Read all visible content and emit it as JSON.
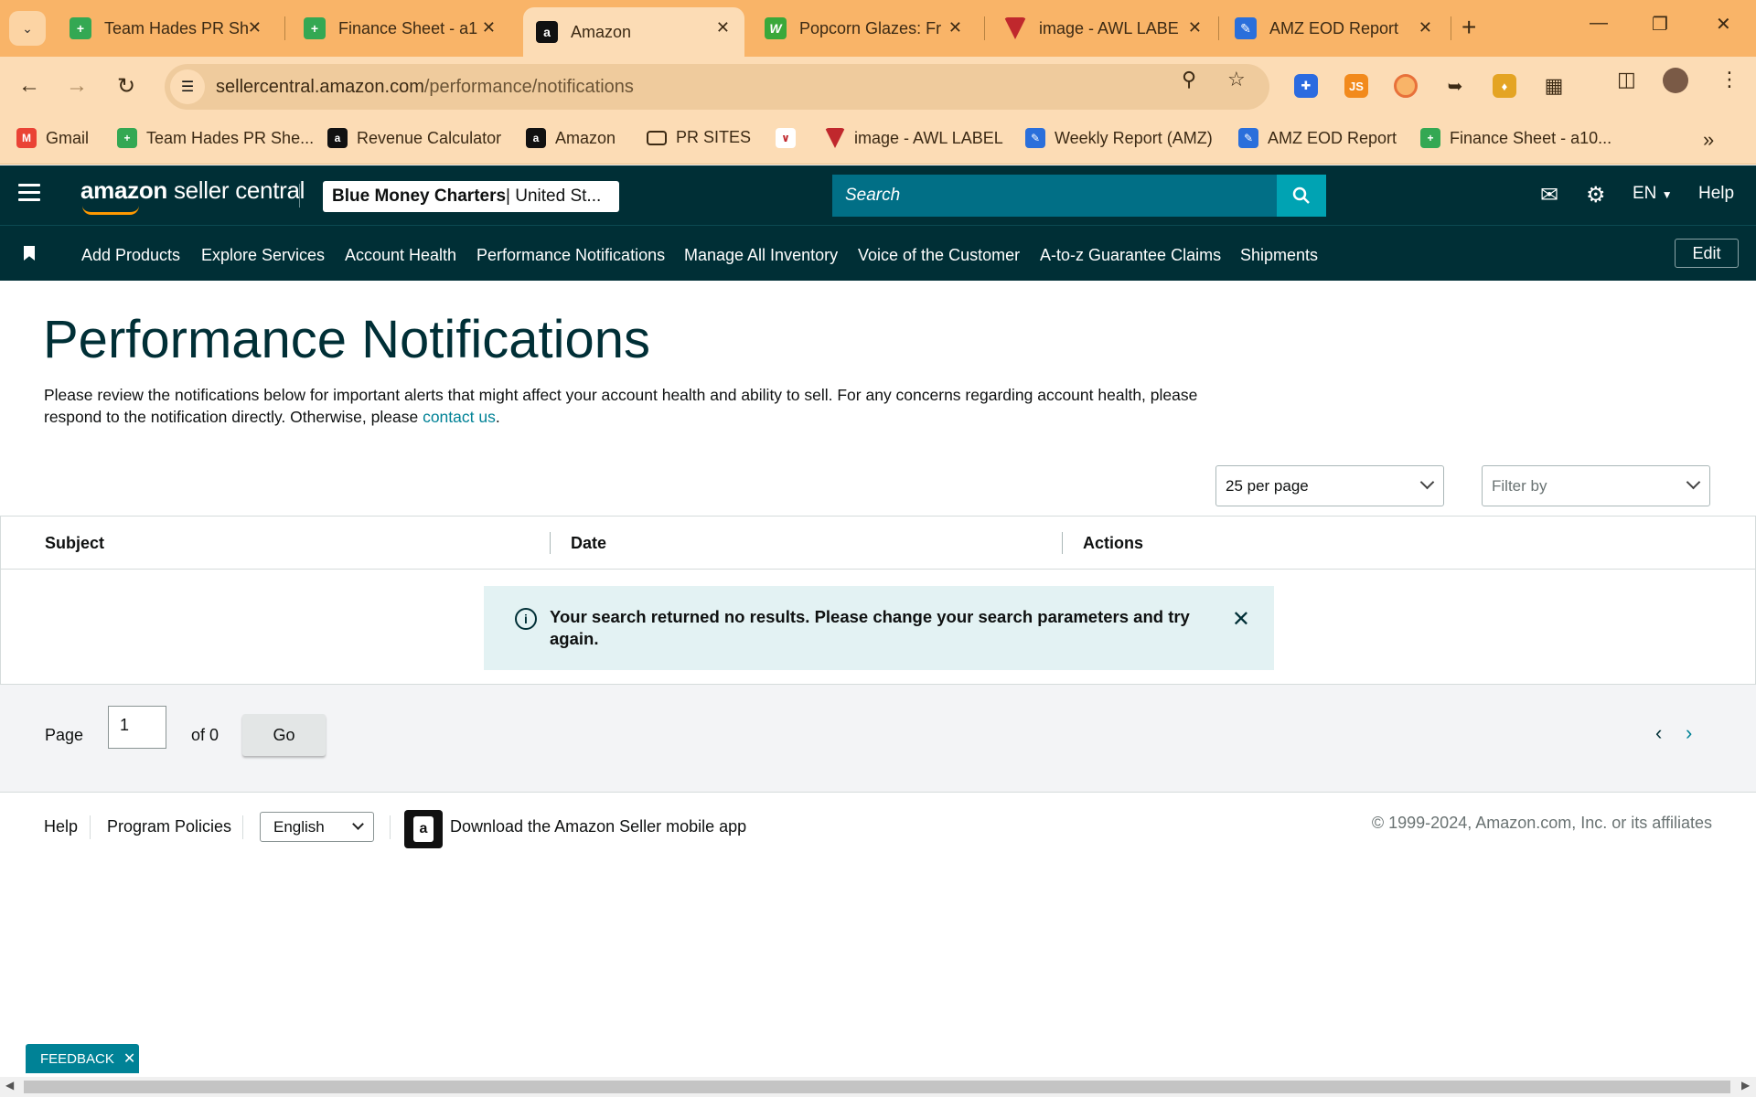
{
  "browser": {
    "tabs": [
      {
        "title": "Team Hades PR Sh",
        "icon": "sheets-plus-icon",
        "color": "#34a853",
        "active": false
      },
      {
        "title": "Finance Sheet - a1",
        "icon": "sheets-plus-icon",
        "color": "#34a853",
        "active": false
      },
      {
        "title": "Amazon",
        "icon": "amazon-a-icon",
        "color": "#111111",
        "active": true
      },
      {
        "title": "Popcorn Glazes: Fr",
        "icon": "w-logo-icon",
        "color": "#3aa83a",
        "active": false
      },
      {
        "title": "image - AWL LABE",
        "icon": "awl-label-icon",
        "color": "#c0282d",
        "active": false
      },
      {
        "title": "AMZ EOD Report",
        "icon": "report-pen-icon",
        "color": "#2a6fdb",
        "active": false
      }
    ],
    "url_domain": "sellercentral.amazon.com",
    "url_path": "/performance/notifications",
    "bookmarks": [
      {
        "label": "Gmail",
        "icon": "gmail-icon"
      },
      {
        "label": "Team Hades PR She...",
        "icon": "sheets-plus-icon"
      },
      {
        "label": "Revenue Calculator",
        "icon": "amazon-a-icon"
      },
      {
        "label": "Amazon",
        "icon": "amazon-a-icon"
      },
      {
        "label": "PR SITES",
        "icon": "folder-icon"
      },
      {
        "label": "",
        "icon": "chart-image-icon"
      },
      {
        "label": "image - AWL LABEL",
        "icon": "awl-label-icon"
      },
      {
        "label": "Weekly Report (AMZ)",
        "icon": "report-pen-icon"
      },
      {
        "label": "AMZ EOD Report",
        "icon": "report-pen-icon"
      },
      {
        "label": "Finance Sheet - a10...",
        "icon": "sheets-plus-icon"
      }
    ]
  },
  "header": {
    "logo_bold": "amazon",
    "logo_rest": " seller central",
    "account_bold": "Blue Money Charters",
    "account_rest": " | United St...",
    "search_placeholder": "Search",
    "language": "EN",
    "help": "Help"
  },
  "nav": {
    "links": [
      "Add Products",
      "Explore Services",
      "Account Health",
      "Performance Notifications",
      "Manage All Inventory",
      "Voice of the Customer",
      "A-to-z Guarantee Claims",
      "Shipments"
    ],
    "edit": "Edit"
  },
  "main": {
    "title": "Performance Notifications",
    "description_1": "Please review the notifications below for important alerts that might affect your account health and ability to sell. For any concerns regarding account health, please respond to the notification directly. Otherwise, please ",
    "contact_link": "contact us",
    "description_2": ".",
    "per_page": "25 per page",
    "filter_placeholder": "Filter by",
    "columns": [
      "Subject",
      "Date",
      "Actions"
    ],
    "alert_message": "Your search returned no results. Please change your search parameters and try again.",
    "pager": {
      "page_label": "Page",
      "page_value": "1",
      "of_label": "of 0",
      "go": "Go"
    }
  },
  "footer": {
    "help": "Help",
    "policies": "Program Policies",
    "language": "English",
    "app_text": "Download the Amazon Seller mobile app",
    "copyright": "© 1999-2024, Amazon.com, Inc. or its affiliates"
  },
  "feedback": "FEEDBACK"
}
